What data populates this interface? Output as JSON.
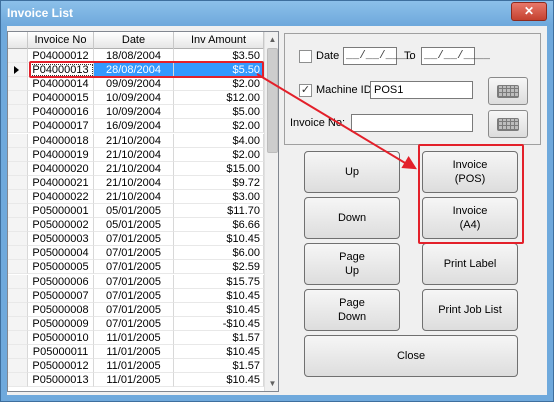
{
  "window": {
    "title": "Invoice List",
    "close_label": "✕"
  },
  "table": {
    "columns": [
      "Invoice No",
      "Date",
      "Inv Amount"
    ],
    "rows": [
      {
        "inv": "P04000012",
        "date": "18/08/2004",
        "amt": "$3.50"
      },
      {
        "inv": "P04000013",
        "date": "28/08/2004",
        "amt": "$5.50",
        "selected": true
      },
      {
        "inv": "P04000014",
        "date": "09/09/2004",
        "amt": "$2.00"
      },
      {
        "inv": "P04000015",
        "date": "10/09/2004",
        "amt": "$12.00"
      },
      {
        "inv": "P04000016",
        "date": "10/09/2004",
        "amt": "$5.00"
      },
      {
        "inv": "P04000017",
        "date": "16/09/2004",
        "amt": "$2.00"
      },
      {
        "inv": "P04000018",
        "date": "21/10/2004",
        "amt": "$4.00"
      },
      {
        "inv": "P04000019",
        "date": "21/10/2004",
        "amt": "$2.00"
      },
      {
        "inv": "P04000020",
        "date": "21/10/2004",
        "amt": "$15.00"
      },
      {
        "inv": "P04000021",
        "date": "21/10/2004",
        "amt": "$9.72"
      },
      {
        "inv": "P04000022",
        "date": "21/10/2004",
        "amt": "$3.00"
      },
      {
        "inv": "P05000001",
        "date": "05/01/2005",
        "amt": "$11.70"
      },
      {
        "inv": "P05000002",
        "date": "05/01/2005",
        "amt": "$6.66"
      },
      {
        "inv": "P05000003",
        "date": "07/01/2005",
        "amt": "$10.45"
      },
      {
        "inv": "P05000004",
        "date": "07/01/2005",
        "amt": "$6.00"
      },
      {
        "inv": "P05000005",
        "date": "07/01/2005",
        "amt": "$2.59"
      },
      {
        "inv": "P05000006",
        "date": "07/01/2005",
        "amt": "$15.75"
      },
      {
        "inv": "P05000007",
        "date": "07/01/2005",
        "amt": "$10.45"
      },
      {
        "inv": "P05000008",
        "date": "07/01/2005",
        "amt": "$10.45"
      },
      {
        "inv": "P05000009",
        "date": "07/01/2005",
        "amt": "-$10.45"
      },
      {
        "inv": "P05000010",
        "date": "11/01/2005",
        "amt": "$1.57"
      },
      {
        "inv": "P05000011",
        "date": "11/01/2005",
        "amt": "$10.45"
      },
      {
        "inv": "P05000012",
        "date": "11/01/2005",
        "amt": "$1.57"
      },
      {
        "inv": "P05000013",
        "date": "11/01/2005",
        "amt": "$10.45"
      }
    ]
  },
  "filters": {
    "date_label": "Date",
    "date_from": "__/__/____",
    "to_label": "To",
    "date_to": "__/__/____",
    "machine_label": "Machine ID",
    "machine_checked_glyph": "✓",
    "machine_value": "POS1",
    "invoice_no_label": "Invoice No:",
    "invoice_no_value": ""
  },
  "buttons": {
    "up": "Up",
    "down": "Down",
    "page_up": "Page\nUp",
    "page_down": "Page\nDown",
    "invoice_pos": "Invoice\n(POS)",
    "invoice_a4": "Invoice\n(A4)",
    "print_label": "Print Label",
    "print_job_list": "Print Job List",
    "close": "Close"
  },
  "icons": {
    "keyboard": "keyboard-icon",
    "scroll_up": "▲",
    "scroll_down": "▼"
  },
  "colors": {
    "annotation": "#e3202a",
    "selection": "#3399ff",
    "title_bar": "#6fa9dc"
  }
}
